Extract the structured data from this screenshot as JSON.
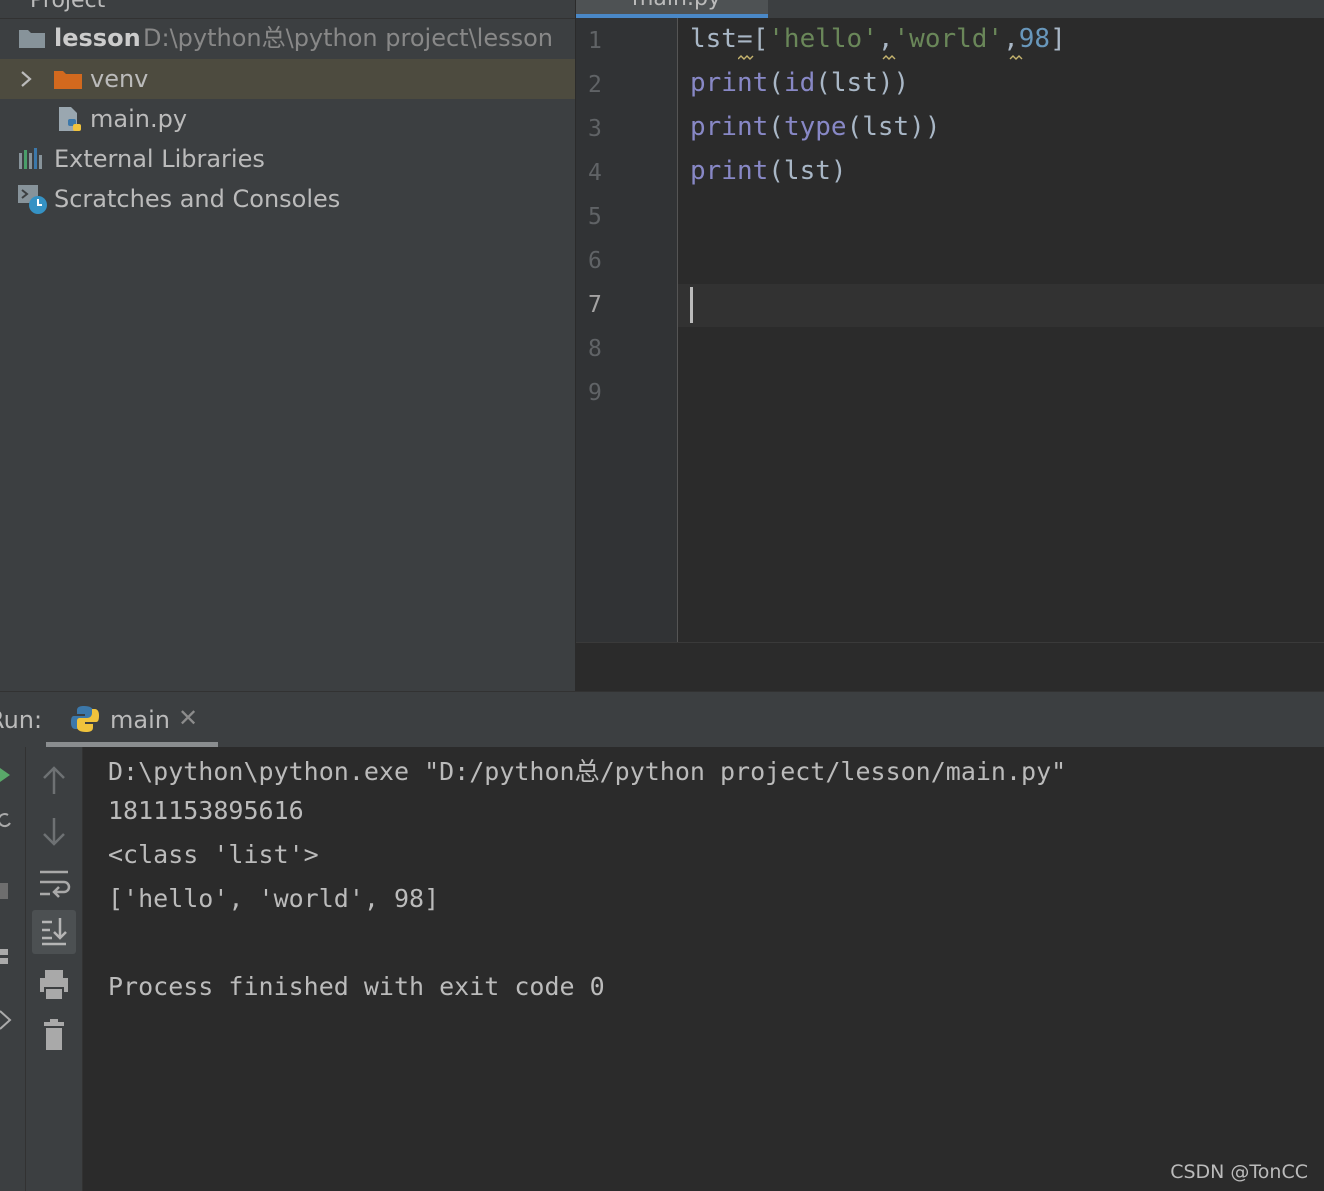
{
  "project": {
    "title": "Project",
    "root": {
      "name": "lesson",
      "path": "D:\\python总\\python project\\lesson"
    },
    "items": [
      {
        "label": "venv"
      },
      {
        "label": "main.py"
      },
      {
        "label": "External Libraries"
      },
      {
        "label": "Scratches and Consoles"
      }
    ]
  },
  "editor": {
    "tab_label": "main.py",
    "line_numbers": [
      "1",
      "2",
      "3",
      "4",
      "5",
      "6",
      "7",
      "8",
      "9"
    ],
    "current_line": "7",
    "code": {
      "l1": {
        "a": "lst=[",
        "s1": "'hello'",
        "c1": ",",
        "s2": "'world'",
        "c2": ",",
        "n": "98",
        "e": "]"
      },
      "l2": {
        "f": "print",
        "p1": "(",
        "f2": "id",
        "r": "(lst))"
      },
      "l3": {
        "f": "print",
        "p1": "(",
        "f2": "type",
        "r": "(lst))"
      },
      "l4": {
        "f": "print",
        "r": "(lst)"
      }
    }
  },
  "run": {
    "label": "Run:",
    "tab_label": "main",
    "console": [
      "D:\\python\\python.exe \"D:/python总/python project/lesson/main.py\"",
      "1811153895616",
      "<class 'list'>",
      "['hello', 'world', 98]",
      "",
      "Process finished with exit code 0"
    ]
  },
  "watermark": "CSDN @TonCC",
  "colors": {
    "keyword": "#8888c6",
    "string": "#6a8759",
    "number": "#6897bb",
    "folder_excluded": "#d2691e",
    "accent_tab": "#4a88c7"
  }
}
